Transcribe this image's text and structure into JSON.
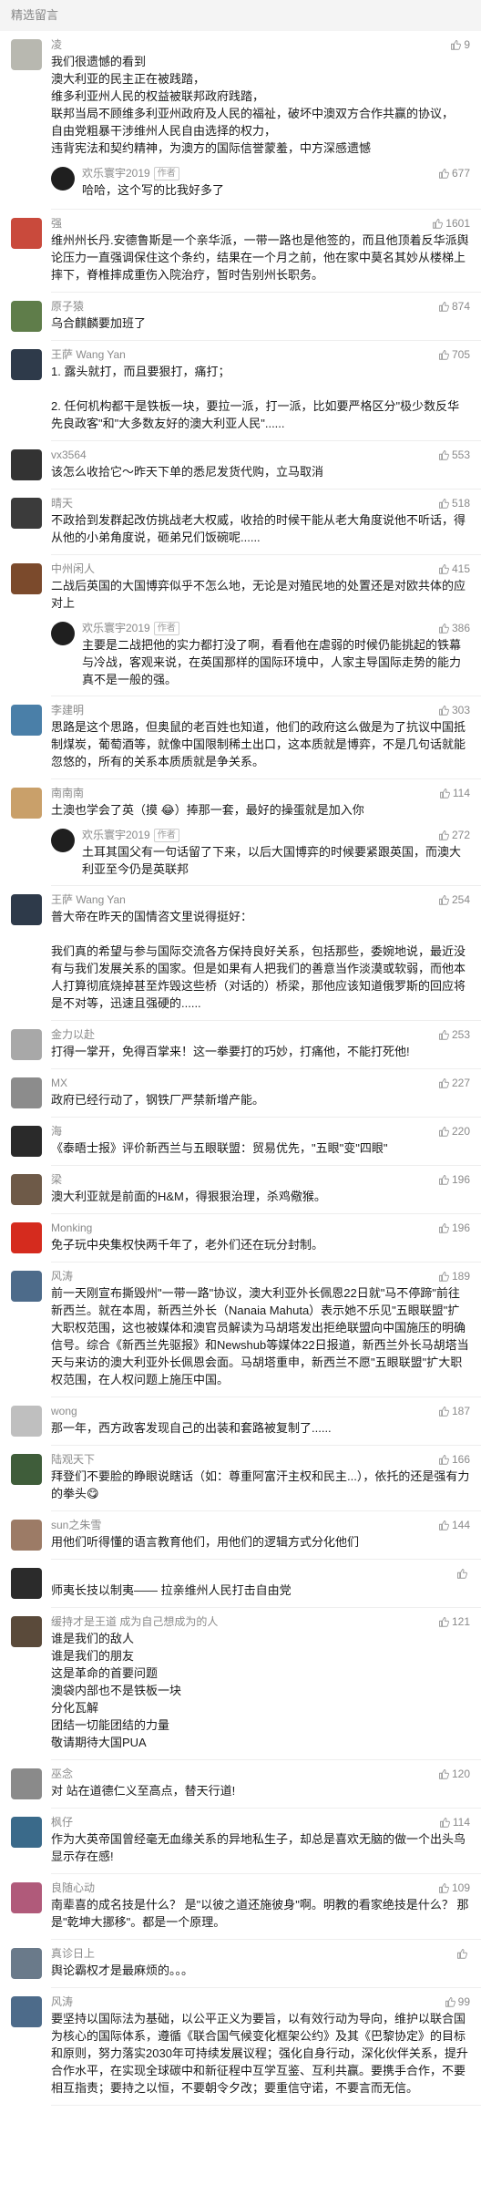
{
  "section": {
    "title": "精选留言"
  },
  "reply_author": {
    "name": "欢乐寰宇2019",
    "tag": "作者"
  },
  "comments": [
    {
      "nick": "凌",
      "avatar_color": "#b8b8b0",
      "likes": "9",
      "text": "我们很遗憾的看到\n澳大利亚的民主正在被践踏，\n维多利亚州人民的权益被联邦政府践踏，\n联邦当局不顾维多利亚州政府及人民的福祉，破坏中澳双方合作共赢的协议，\n自由党粗暴干涉维州人民自由选择的权力，\n违背宪法和契约精神，为澳方的国际信誉蒙羞，中方深感遗憾",
      "reply": {
        "likes": "677",
        "text": "哈哈，这个写的比我好多了"
      }
    },
    {
      "nick": "强",
      "avatar_color": "#c94a3c",
      "likes": "1601",
      "text": "维州州长丹.安德鲁斯是一个亲华派，一带一路也是他签的，而且他顶着反华派舆论压力一直强调保住这个条约，结果在一个月之前，他在家中莫名其妙从楼梯上摔下，脊椎摔成重伤入院治疗，暂时告别州长职务。",
      "reply": null
    },
    {
      "nick": "原子猿",
      "avatar_color": "#5f7d4a",
      "likes": "874",
      "text": "乌合麒麟要加班了",
      "reply": null
    },
    {
      "nick": "王萨 Wang Yan",
      "avatar_color": "#2e3a4a",
      "likes": "705",
      "text": "1. 露头就打，而且要狠打，痛打；\n\n2. 任何机构都干是铁板一块，要拉一派，打一派，比如要严格区分\"极少数反华先良政客\"和\"大多数友好的澳大利亚人民\"......",
      "reply": null
    },
    {
      "nick": "vx3564",
      "avatar_color": "#333333",
      "likes": "553",
      "text": "该怎么收拾它～昨天下单的悉尼发货代购，立马取消",
      "reply": null
    },
    {
      "nick": "晴天",
      "avatar_color": "#3b3b3b",
      "likes": "518",
      "text": "不政拾到发群起改仿挑战老大权威，收拾的时候干能从老大角度说他不听话，得从他的小弟角度说，砸弟兄们饭碗呢......",
      "reply": null
    },
    {
      "nick": "中州闲人",
      "avatar_color": "#7b4a2c",
      "likes": "415",
      "text": "二战后英国的大国博弈似乎不怎么地，无论是对殖民地的处置还是对欧共体的应对上",
      "reply": {
        "likes": "386",
        "text": "主要是二战把他的实力都打没了啊，看看他在虐弱的时候仍能挑起的铁幕与冷战，客观来说，在英国那样的国际环境中，人家主导国际走势的能力真不是一般的强。"
      }
    },
    {
      "nick": "李建明",
      "avatar_color": "#4a7fa8",
      "likes": "303",
      "text": "思路是这个思路，但奥鼠的老百姓也知道，他们的政府这么做是为了抗议中国抵制煤炭，葡萄酒等，就像中国限制稀土出口，这本质就是博弈，不是几句话就能忽悠的，所有的关系本质质就是争关系。",
      "reply": null
    },
    {
      "nick": "南南南",
      "avatar_color": "#c9a06a",
      "likes": "114",
      "text": "土澳也学会了英（摸 😂）捧那一套，最好的操蛋就是加入你",
      "reply": {
        "likes": "272",
        "text": "土耳其国父有一句话留了下来，以后大国博弈的时候要紧跟英国，而澳大利亚至今仍是英联邦"
      }
    },
    {
      "nick": "王萨 Wang Yan",
      "avatar_color": "#2e3a4a",
      "likes": "254",
      "text": "普大帝在昨天的国情咨文里说得挺好：\n\n我们真的希望与参与国际交流各方保持良好关系，包括那些，委婉地说，最近没有与我们发展关系的国家。但是如果有人把我们的善意当作淡漠或软弱，而他本人打算彻底烧掉甚至炸毁这些桥（对话的）桥梁，那他应该知道俄罗斯的回应将是不对等，迅速且强硬的......",
      "reply": null
    },
    {
      "nick": "金力以赴",
      "avatar_color": "#a8a8a8",
      "likes": "253",
      "text": "打得一掌开，免得百掌来！这一拳要打的巧妙，打痛他，不能打死他!",
      "reply": null
    },
    {
      "nick": "MX",
      "avatar_color": "#8c8c8c",
      "likes": "227",
      "text": "政府已经行动了，钢铁厂严禁新增产能。",
      "reply": null
    },
    {
      "nick": "海",
      "avatar_color": "#2a2a2a",
      "likes": "220",
      "text": "《泰晤士报》评价新西兰与五眼联盟：贸易优先，\"五眼\"变\"四眼\"",
      "reply": null
    },
    {
      "nick": "梁",
      "avatar_color": "#6e5a48",
      "likes": "196",
      "text": "澳大利亚就是前面的H&M，得狠狠治理，杀鸡儆猴。",
      "reply": null
    },
    {
      "nick": "Monking",
      "avatar_color": "#d52b1e",
      "likes": "196",
      "text": "免子玩中央集权快两千年了，老外们还在玩分封制。",
      "reply": null
    },
    {
      "nick": "风涛",
      "avatar_color": "#4d6b8a",
      "likes": "189",
      "text": "前一天刚宣布撕毁州\"一带一路\"协议，澳大利亚外长佩恩22日就\"马不停蹄\"前往新西兰。就在本周，新西兰外长（Nanaia Mahuta）表示她不乐见\"五眼联盟\"扩大职权范围，这也被媒体和澳官员解读为马胡塔发出拒绝联盟向中国施压的明确信号。综合《新西兰先驱报》和Newshub等媒体22日报道，新西兰外长马胡塔当天与来访的澳大利亚外长佩恩会面。马胡塔重申，新西兰不愿\"五眼联盟\"扩大职权范围，在人权问题上施压中国。",
      "reply": null
    },
    {
      "nick": "wong",
      "avatar_color": "#bfbfbf",
      "likes": "187",
      "text": "那一年，西方政客发现自己的出装和套路被复制了......",
      "reply": null
    },
    {
      "nick": "陆观天下",
      "avatar_color": "#3f5d3a",
      "likes": "166",
      "text": "拜登们不要脸的睁眼说瞎话（如：尊重阿富汗主权和民主...），依托的还是强有力的拳头😋",
      "reply": null
    },
    {
      "nick": "sun之朱雪",
      "avatar_color": "#9c7b66",
      "likes": "144",
      "text": "用他们听得懂的语言教育他们，用他们的逻辑方式分化他们",
      "reply": null
    },
    {
      "nick": "",
      "avatar_color": "#2b2b2b",
      "likes": "",
      "text": "师夷长技以制夷—— 拉亲维州人民打击自由党",
      "reply": null
    },
    {
      "nick": "缓持才是王道  成为自己想成为的人",
      "avatar_color": "#5a4a3a",
      "likes": "121",
      "text": "谁是我们的敌人\n谁是我们的朋友\n这是革命的首要问题\n澳袋内部也不是铁板一块\n分化瓦解\n团结一切能团结的力量\n敬请期待大国PUA",
      "reply": null
    },
    {
      "nick": "巫念",
      "avatar_color": "#8a8a8a",
      "likes": "120",
      "text": "对 站在道德仁义至高点，替天行道!",
      "reply": null
    },
    {
      "nick": "枫仔",
      "avatar_color": "#3a6a8a",
      "likes": "114",
      "text": "作为大英帝国曾经毫无血缘关系的异地私生子，却总是喜欢无脑的做一个出头鸟显示存在感!",
      "reply": null
    },
    {
      "nick": "良随心动",
      "avatar_color": "#b05a7a",
      "likes": "109",
      "text": "南辈喜的成名技是什么？ 是\"以彼之道还施彼身\"啊。明教的看家绝技是什么？ 那是\"乾坤大挪移\"。都是一个原理。",
      "reply": null
    },
    {
      "nick": "真诊日上",
      "avatar_color": "#6a7a8a",
      "likes": "",
      "text": "舆论霸权才是最麻烦的。。。",
      "reply": null
    },
    {
      "nick": "风涛",
      "avatar_color": "#4d6b8a",
      "likes": "99",
      "text": "要坚持以国际法为基础，以公平正义为要旨，以有效行动为导向，维护以联合国为核心的国际体系，遵循《联合国气候变化框架公约》及其《巴黎协定》的目标和原则，努力落实2030年可持续发展议程；强化自身行动，深化伙伴关系，提升合作水平，在实现全球碳中和新征程中互学互鉴、互利共赢。要携手合作，不要相互指责；要持之以恒，不要朝令夕改；要重信守诺，不要言而无信。",
      "reply": null
    }
  ]
}
